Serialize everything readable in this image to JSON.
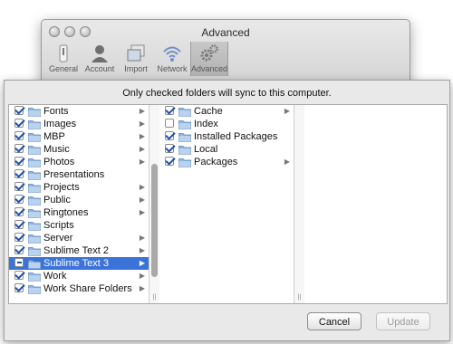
{
  "window": {
    "title": "Advanced",
    "toolbar": [
      {
        "label": "General",
        "icon": "general-icon"
      },
      {
        "label": "Account",
        "icon": "account-icon"
      },
      {
        "label": "Import",
        "icon": "import-icon"
      },
      {
        "label": "Network",
        "icon": "network-icon"
      },
      {
        "label": "Advanced",
        "icon": "gears-icon",
        "selected": true
      }
    ]
  },
  "sheet": {
    "message": "Only checked folders will sync to this computer.",
    "column1": [
      {
        "name": "Fonts",
        "state": "checked",
        "has_children": true
      },
      {
        "name": "Images",
        "state": "checked",
        "has_children": true
      },
      {
        "name": "MBP",
        "state": "checked",
        "has_children": true
      },
      {
        "name": "Music",
        "state": "checked",
        "has_children": true
      },
      {
        "name": "Photos",
        "state": "checked",
        "has_children": true
      },
      {
        "name": "Presentations",
        "state": "checked",
        "has_children": false
      },
      {
        "name": "Projects",
        "state": "checked",
        "has_children": true
      },
      {
        "name": "Public",
        "state": "checked",
        "has_children": true
      },
      {
        "name": "Ringtones",
        "state": "checked",
        "has_children": true
      },
      {
        "name": "Scripts",
        "state": "checked",
        "has_children": false
      },
      {
        "name": "Server",
        "state": "checked",
        "has_children": true
      },
      {
        "name": "Sublime Text 2",
        "state": "checked",
        "has_children": true
      },
      {
        "name": "Sublime Text 3",
        "state": "mixed",
        "has_children": true,
        "selected": true
      },
      {
        "name": "Work",
        "state": "checked",
        "has_children": true
      },
      {
        "name": "Work Share Folders",
        "state": "checked",
        "has_children": true
      }
    ],
    "column2": [
      {
        "name": "Cache",
        "state": "checked",
        "has_children": true
      },
      {
        "name": "Index",
        "state": "unchecked",
        "has_children": false
      },
      {
        "name": "Installed Packages",
        "state": "checked",
        "has_children": false
      },
      {
        "name": "Local",
        "state": "checked",
        "has_children": false
      },
      {
        "name": "Packages",
        "state": "checked",
        "has_children": true
      }
    ],
    "buttons": {
      "cancel": "Cancel",
      "update": "Update"
    }
  },
  "colors": {
    "selection": "#3b73d9",
    "checkmark": "#1e4fa8",
    "folder": "#8fb6e0"
  }
}
